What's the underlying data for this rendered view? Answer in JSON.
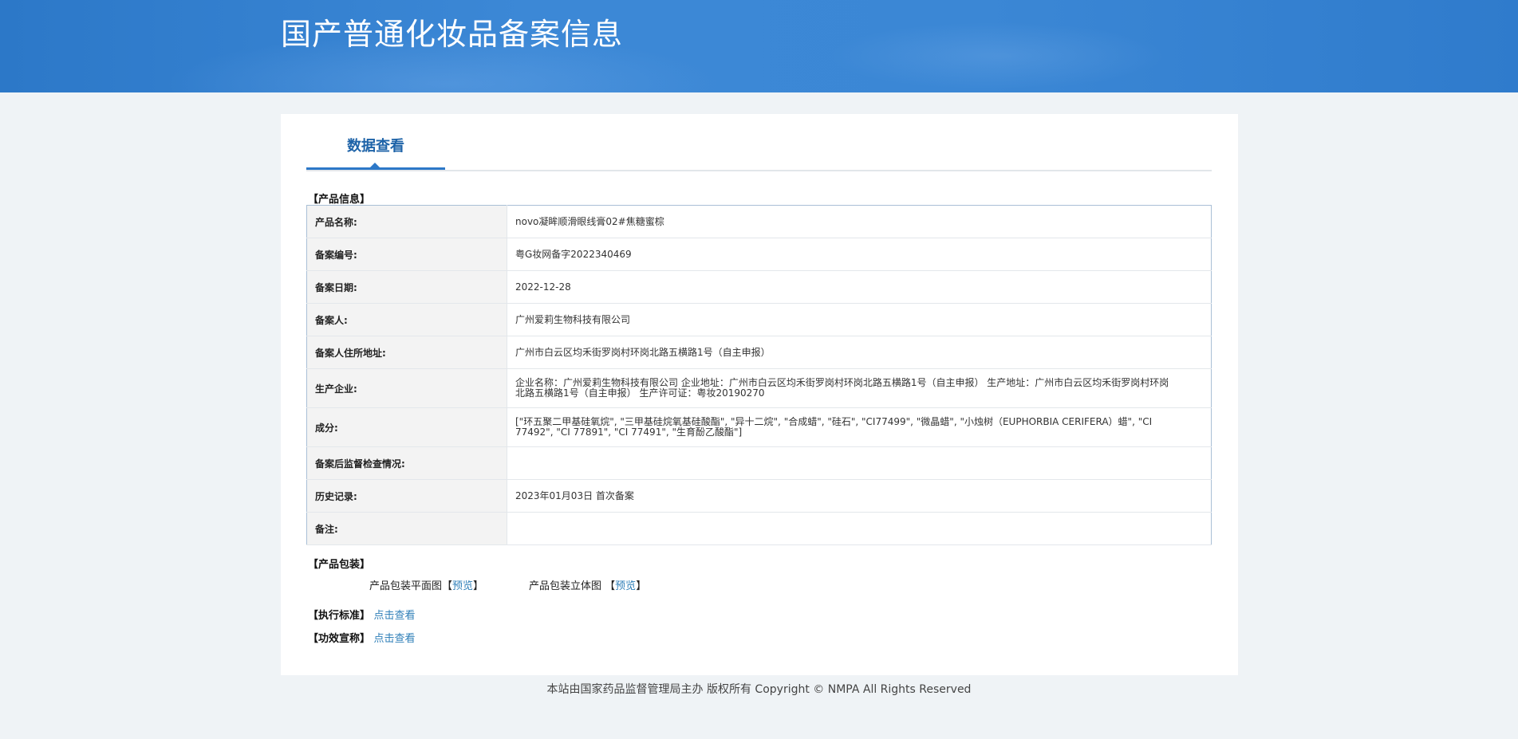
{
  "header": {
    "title": "国产普通化妆品备案信息"
  },
  "tabs": {
    "active_label": "数据查看"
  },
  "product_info": {
    "section_title": "【产品信息】",
    "rows": [
      {
        "label": "产品名称:",
        "value": "novo凝眸顺滑眼线膏02#焦糖蜜棕"
      },
      {
        "label": "备案编号:",
        "value": "粤G妆网备字2022340469"
      },
      {
        "label": "备案日期:",
        "value": "2022-12-28"
      },
      {
        "label": "备案人:",
        "value": "广州爱莉生物科技有限公司"
      },
      {
        "label": "备案人住所地址:",
        "value": "广州市白云区均禾街罗岗村环岗北路五横路1号（自主申报）"
      },
      {
        "label": "生产企业:",
        "value": "企业名称：广州爱莉生物科技有限公司 企业地址：广州市白云区均禾街罗岗村环岗北路五横路1号（自主申报） 生产地址：广州市白云区均禾街罗岗村环岗北路五横路1号（自主申报） 生产许可证：粤妆20190270"
      },
      {
        "label": "成分:",
        "value": "[\"环五聚二甲基硅氧烷\", \"三甲基硅烷氧基硅酸酯\", \"异十二烷\", \"合成蜡\", \"硅石\", \"CI77499\", \"微晶蜡\", \"小烛树（EUPHORBIA CERIFERA）蜡\", \"CI 77492\", \"CI 77891\", \"CI 77491\", \"生育酚乙酸酯\"]"
      },
      {
        "label": "备案后监督检查情况:",
        "value": ""
      },
      {
        "label": "历史记录:",
        "value": "2023年01月03日 首次备案"
      },
      {
        "label": "备注:",
        "value": ""
      }
    ]
  },
  "packaging": {
    "section_title": "【产品包装】",
    "flat_label": "产品包装平面图",
    "solid_label": "产品包装立体图",
    "bracket_open": "【",
    "bracket_close": "】",
    "preview_link": "预览"
  },
  "standard": {
    "label": "【执行标准】",
    "link": "点击查看"
  },
  "efficacy": {
    "label": "【功效宣称】",
    "link": "点击查看"
  },
  "footer": {
    "text": "本站由国家药品监督管理局主办 版权所有 Copyright © NMPA All Rights Reserved"
  }
}
